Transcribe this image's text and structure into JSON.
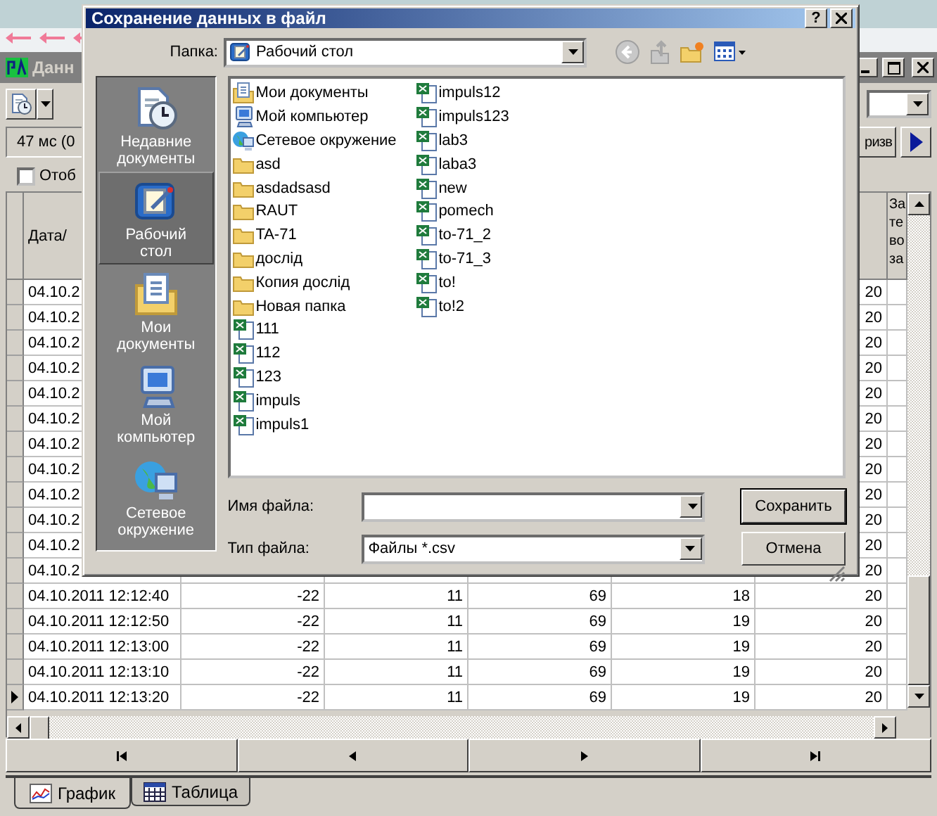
{
  "app": {
    "title": "Данн",
    "delay": "47 мс (0",
    "action_button": "ризв",
    "checkbox": {
      "label": "Отоб",
      "checked": false
    }
  },
  "table": {
    "date_header": "Дата/",
    "column_7_header": "За те во за",
    "rows": [
      {
        "date": "04.10.2",
        "column_6": "20",
        "current": false
      },
      {
        "date": "04.10.2",
        "column_6": "20",
        "current": false
      },
      {
        "date": "04.10.2",
        "column_6": "20",
        "current": false
      },
      {
        "date": "04.10.2",
        "column_6": "20",
        "current": false
      },
      {
        "date": "04.10.2",
        "column_6": "20",
        "current": false
      },
      {
        "date": "04.10.2",
        "column_6": "20",
        "current": false
      },
      {
        "date": "04.10.2",
        "column_6": "20",
        "current": false
      },
      {
        "date": "04.10.2",
        "column_6": "20",
        "current": false
      },
      {
        "date": "04.10.2",
        "column_6": "20",
        "current": false
      },
      {
        "date": "04.10.2",
        "column_6": "20",
        "current": false
      },
      {
        "date": "04.10.2",
        "column_6": "20",
        "current": false
      },
      {
        "date": "04.10.2",
        "column_6": "20",
        "current": false
      },
      {
        "date": "04.10.2011 12:12:40",
        "column_2": "-22",
        "column_3": "11",
        "column_4": "69",
        "column_5": "18",
        "column_6": "20",
        "current": false
      },
      {
        "date": "04.10.2011 12:12:50",
        "column_2": "-22",
        "column_3": "11",
        "column_4": "69",
        "column_5": "19",
        "column_6": "20",
        "current": false
      },
      {
        "date": "04.10.2011 12:13:00",
        "column_2": "-22",
        "column_3": "11",
        "column_4": "69",
        "column_5": "19",
        "column_6": "20",
        "current": false
      },
      {
        "date": "04.10.2011 12:13:10",
        "column_2": "-22",
        "column_3": "11",
        "column_4": "69",
        "column_5": "19",
        "column_6": "20",
        "current": false
      },
      {
        "date": "04.10.2011 12:13:20",
        "column_2": "-22",
        "column_3": "11",
        "column_4": "69",
        "column_5": "19",
        "column_6": "20",
        "current": true
      }
    ]
  },
  "navigation": [
    {
      "kind": "first"
    },
    {
      "kind": "previous"
    },
    {
      "kind": "next"
    },
    {
      "kind": "last"
    }
  ],
  "tabs": [
    {
      "label": "График",
      "kind": "chart",
      "selected": true
    },
    {
      "label": "Таблица",
      "kind": "table",
      "selected": false
    }
  ],
  "dialog": {
    "title": "Сохранение данных в файл",
    "help_button": "?",
    "folder_label": "Папка:",
    "folder": "Рабочий стол",
    "places": [
      {
        "label": "Недавние документы",
        "kind": "recent",
        "selected": false
      },
      {
        "label": "Рабочий стол",
        "kind": "desktop",
        "selected": true
      },
      {
        "label": "Мои документы",
        "kind": "documents",
        "selected": false
      },
      {
        "label": "Мой компьютер",
        "kind": "computer",
        "selected": false
      },
      {
        "label": "Сетевое окружение",
        "kind": "network",
        "selected": false
      }
    ],
    "files": [
      {
        "name": "Мои документы",
        "kind": "documents"
      },
      {
        "name": "Мой компьютер",
        "kind": "computer"
      },
      {
        "name": "Сетевое окружение",
        "kind": "network"
      },
      {
        "name": "asd",
        "kind": "folder"
      },
      {
        "name": "asdadsasd",
        "kind": "folder"
      },
      {
        "name": "RAUT",
        "kind": "folder"
      },
      {
        "name": "TA-71",
        "kind": "folder"
      },
      {
        "name": "дослід",
        "kind": "folder"
      },
      {
        "name": "Копия дослід",
        "kind": "folder"
      },
      {
        "name": "Новая папка",
        "kind": "folder"
      },
      {
        "name": "111",
        "kind": "spreadsheet"
      },
      {
        "name": "112",
        "kind": "spreadsheet"
      },
      {
        "name": "123",
        "kind": "spreadsheet"
      },
      {
        "name": "impuls",
        "kind": "spreadsheet"
      },
      {
        "name": "impuls1",
        "kind": "spreadsheet"
      },
      {
        "name": "impuls12",
        "kind": "spreadsheet"
      },
      {
        "name": "impuls123",
        "kind": "spreadsheet"
      },
      {
        "name": "lab3",
        "kind": "spreadsheet"
      },
      {
        "name": "laba3",
        "kind": "spreadsheet"
      },
      {
        "name": "new",
        "kind": "spreadsheet"
      },
      {
        "name": "pomech",
        "kind": "spreadsheet"
      },
      {
        "name": "to-71_2",
        "kind": "spreadsheet"
      },
      {
        "name": "to-71_3",
        "kind": "spreadsheet"
      },
      {
        "name": "to!",
        "kind": "spreadsheet"
      },
      {
        "name": "to!2",
        "kind": "spreadsheet"
      }
    ],
    "file_name_label": "Имя файла:",
    "file_type": {
      "label": "Тип файла:",
      "value": "Файлы *.csv"
    },
    "buttons": [
      {
        "label": "Сохранить",
        "kind": "default"
      },
      {
        "label": "Отмена",
        "kind": "normal"
      }
    ]
  }
}
